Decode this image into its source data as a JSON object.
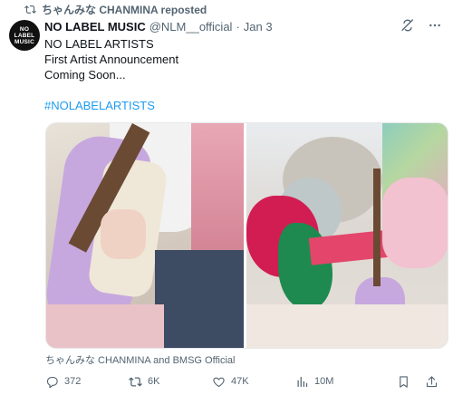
{
  "repost": {
    "text": "ちゃんみな CHANMINA reposted"
  },
  "tweet": {
    "avatar": {
      "line1": "NO",
      "line2": "LABEL",
      "line3": "MUSIC"
    },
    "name": "NO LABEL MUSIC",
    "handle": "@NLM__official",
    "separator": "·",
    "date": "Jan 3",
    "lines": [
      "NO LABEL ARTISTS",
      "First Artist Announcement",
      "Coming Soon..."
    ],
    "hashtag": "#NOLABELARTISTS",
    "media_credit": "ちゃんみな CHANMINA and BMSG Official"
  },
  "actions": {
    "replies": "372",
    "reposts": "6K",
    "likes": "47K",
    "views": "10M"
  },
  "colors": {
    "accent": "#1d9bf0",
    "muted": "#536471",
    "text": "#0f1419"
  },
  "icons": {
    "repost": "repost-icon",
    "grok": "grok-icon",
    "more": "more-icon",
    "reply": "reply-icon",
    "like": "heart-icon",
    "views": "views-icon",
    "bookmark": "bookmark-icon",
    "share": "share-icon",
    "person": "person-icon"
  }
}
